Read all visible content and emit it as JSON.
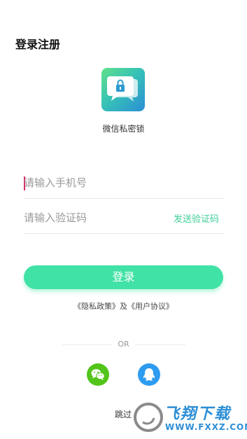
{
  "header": {
    "title": "登录注册"
  },
  "app": {
    "name": "微信私密锁",
    "icon": "chat-lock-icon"
  },
  "form": {
    "phone_placeholder": "请输入手机号",
    "code_placeholder": "请输入验证码",
    "send_code_label": "发送验证码"
  },
  "actions": {
    "login_label": "登录"
  },
  "agreement": {
    "privacy_label": "《隐私政策》",
    "connector": "及",
    "terms_label": "《用户协议》"
  },
  "divider": {
    "label": "OR"
  },
  "social": [
    {
      "name": "wechat",
      "icon": "wechat-icon",
      "color": "#52c41a"
    },
    {
      "name": "qq",
      "icon": "qq-icon",
      "color": "#2d9cf0"
    }
  ],
  "skip": {
    "label": "跳过"
  },
  "watermark": {
    "title": "飞翔下载",
    "url": "WWW.FXXZ.COM",
    "icon": "swirl-logo-icon"
  },
  "colors": {
    "accent": "#41e2a6",
    "link": "#3fcf9a"
  }
}
